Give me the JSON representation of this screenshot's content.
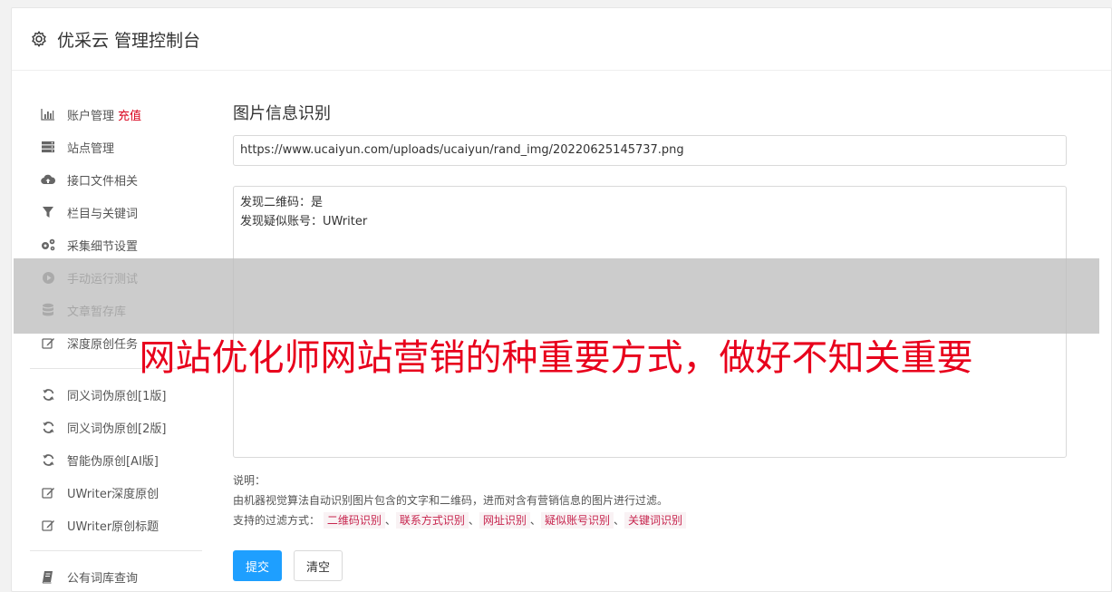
{
  "header": {
    "title": "优采云 管理控制台",
    "icon": "gear-icon"
  },
  "sidebar": {
    "group1": [
      {
        "label": "账户管理",
        "badge": "充值",
        "icon": "bar-chart-icon"
      },
      {
        "label": "站点管理",
        "icon": "server-icon"
      },
      {
        "label": "接口文件相关",
        "icon": "cloud-upload-icon"
      },
      {
        "label": "栏目与关键词",
        "icon": "filter-icon"
      },
      {
        "label": "采集细节设置",
        "icon": "gears-icon"
      },
      {
        "label": "手动运行测试",
        "icon": "play-circle-icon"
      },
      {
        "label": "文章暂存库",
        "icon": "database-icon"
      },
      {
        "label": "深度原创任务",
        "icon": "edit-icon"
      }
    ],
    "group2": [
      {
        "label": "同义词伪原创[1版]",
        "icon": "refresh-icon"
      },
      {
        "label": "同义词伪原创[2版]",
        "icon": "refresh-icon"
      },
      {
        "label": "智能伪原创[AI版]",
        "icon": "refresh-icon"
      },
      {
        "label": "UWriter深度原创",
        "icon": "edit-icon"
      },
      {
        "label": "UWriter原创标题",
        "icon": "edit-icon"
      }
    ],
    "group3": [
      {
        "label": "公有词库查询",
        "icon": "book-icon"
      }
    ]
  },
  "main": {
    "title": "图片信息识别",
    "url_value": "https://www.ucaiyun.com/uploads/ucaiyun/rand_img/20220625145737.png",
    "result_lines": [
      "发现二维码：是",
      "发现疑似账号：UWriter"
    ],
    "desc_label": "说明：",
    "desc_text": "由机器视觉算法自动识别图片包含的文字和二维码，进而对含有营销信息的图片进行过滤。",
    "filters_label": "支持的过滤方式：",
    "filters": [
      "二维码识别",
      "联系方式识别",
      "网址识别",
      "疑似账号识别",
      "关键词识别"
    ],
    "separator": "、",
    "submit_label": "提交",
    "clear_label": "清空"
  },
  "overlay": {
    "text": "网站优化师网站营销的种重要方式，做好不知关重要"
  }
}
